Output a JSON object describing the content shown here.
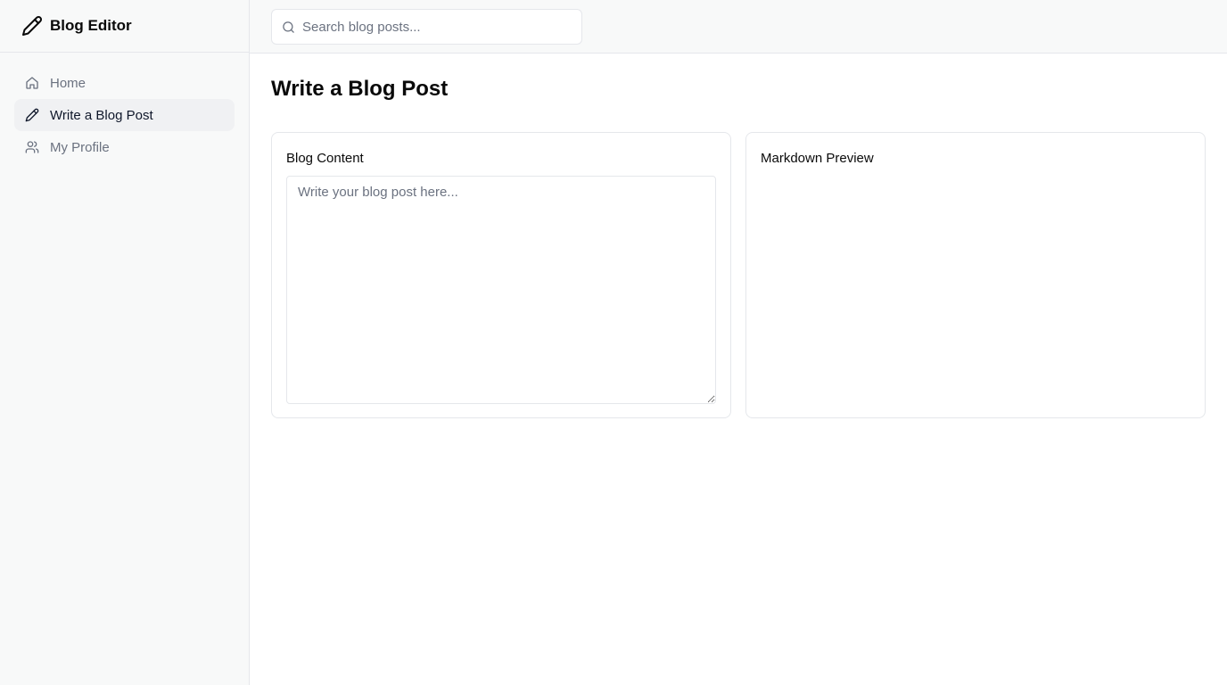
{
  "app": {
    "title": "Blog Editor",
    "icon": "pencil-icon"
  },
  "sidebar": {
    "items": [
      {
        "label": "Home",
        "icon": "home-icon",
        "active": false
      },
      {
        "label": "Write a Blog Post",
        "icon": "pencil-icon",
        "active": true
      },
      {
        "label": "My Profile",
        "icon": "users-icon",
        "active": false
      }
    ]
  },
  "search": {
    "placeholder": "Search blog posts...",
    "value": ""
  },
  "main": {
    "title": "Write a Blog Post",
    "editor": {
      "title": "Blog Content",
      "placeholder": "Write your blog post here...",
      "value": ""
    },
    "preview": {
      "title": "Markdown Preview"
    }
  }
}
